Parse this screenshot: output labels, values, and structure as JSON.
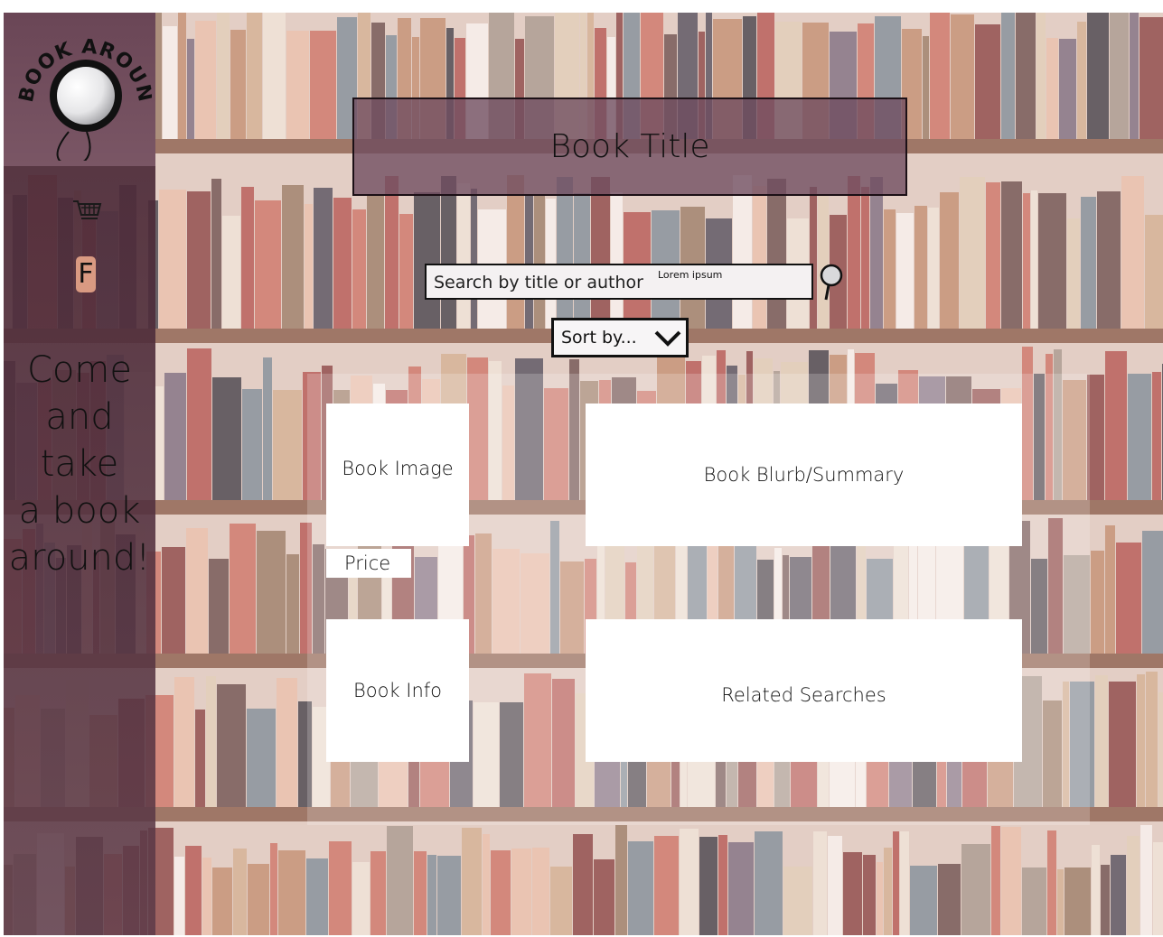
{
  "brand": {
    "logo_text": "BOOK AROUND",
    "tagline_lines": [
      "Come",
      "and",
      "take",
      "a book",
      "around!"
    ]
  },
  "sidebar": {
    "icons": [
      {
        "name": "cart-icon",
        "glyph": "cart"
      },
      {
        "name": "facebook-icon",
        "glyph": "F"
      }
    ],
    "facebook_letter": "F"
  },
  "header": {
    "title": "Book Title"
  },
  "search": {
    "placeholder": "Search by title or author",
    "hint": "Lorem ipsum"
  },
  "sort": {
    "label": "Sort by..."
  },
  "panels": {
    "book_image": "Book Image",
    "price": "Price",
    "blurb": "Book Blurb/Summary",
    "info": "Book Info",
    "related": "Related Searches"
  },
  "colors": {
    "sidebar": "#5a3444",
    "title_box": "#6e4b5f",
    "facebook_badge": "#d99a82",
    "panel": "#ffffff"
  }
}
